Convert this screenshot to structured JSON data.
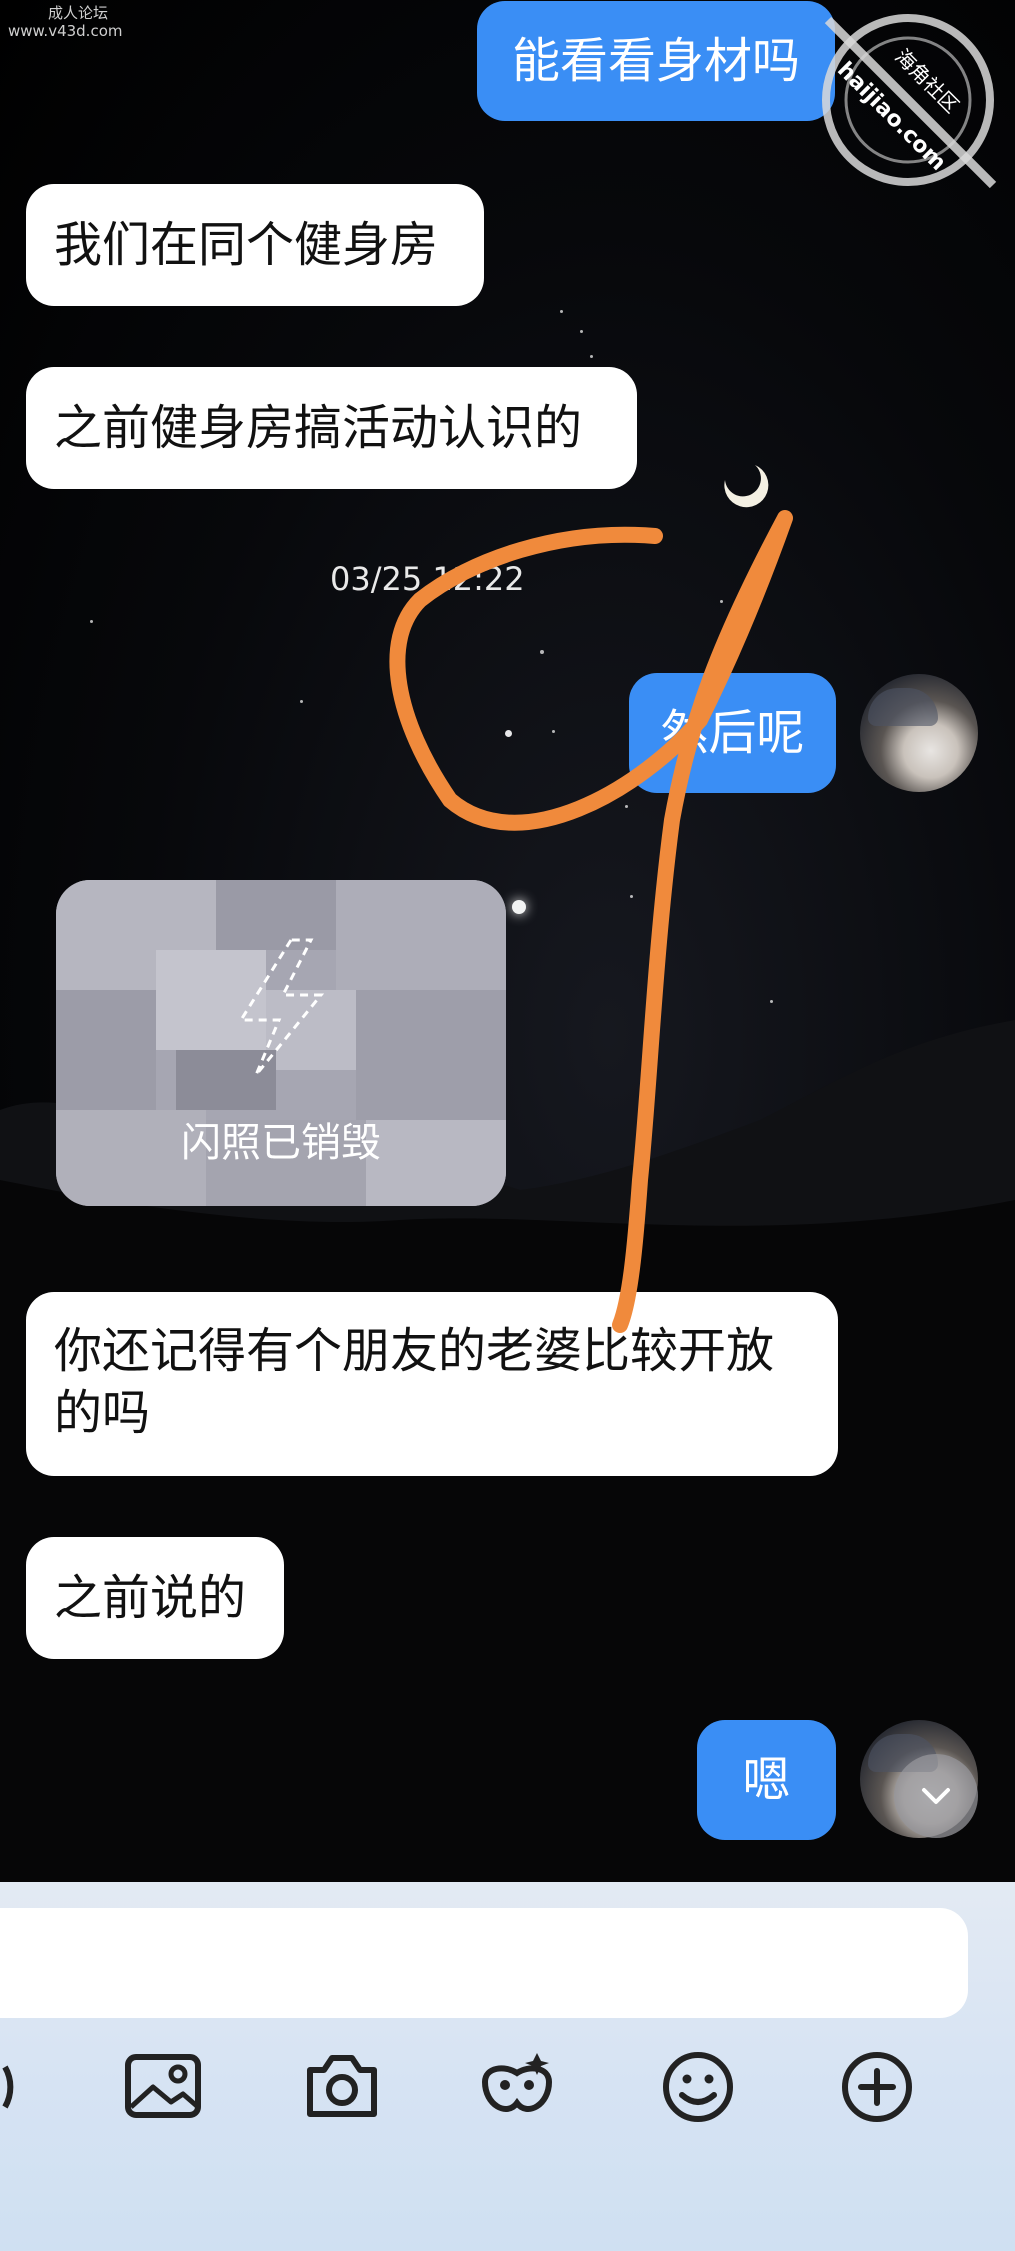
{
  "watermark": {
    "site_name": "成人论坛",
    "site_url": "www.v43d.com",
    "seal_text_1": "海角社区",
    "seal_text_2": "haijiao.com"
  },
  "messages": [
    {
      "side": "out",
      "text": "能看看身材吗"
    },
    {
      "side": "in",
      "text": "我们在同个健身房"
    },
    {
      "side": "in",
      "text": "之前健身房搞活动认识的"
    },
    {
      "side": "time",
      "text": "03/25 12:22"
    },
    {
      "side": "out",
      "text": "然后呢"
    },
    {
      "side": "in",
      "type": "flash_photo",
      "text": "闪照已销毁"
    },
    {
      "side": "in",
      "text": "你还记得有个朋友的老婆比较开放的吗"
    },
    {
      "side": "in",
      "text": "之前说的"
    },
    {
      "side": "out",
      "text": "嗯"
    }
  ],
  "composer": {
    "input_value": "",
    "toolbar_icons": [
      "voice-icon",
      "image-icon",
      "camera-icon",
      "magic-mask-icon",
      "emoji-icon",
      "plus-icon"
    ]
  },
  "colors": {
    "outgoing_bubble": "#3a8ef5",
    "incoming_bubble": "#ffffff",
    "annotation_stroke": "#f08a3c"
  }
}
